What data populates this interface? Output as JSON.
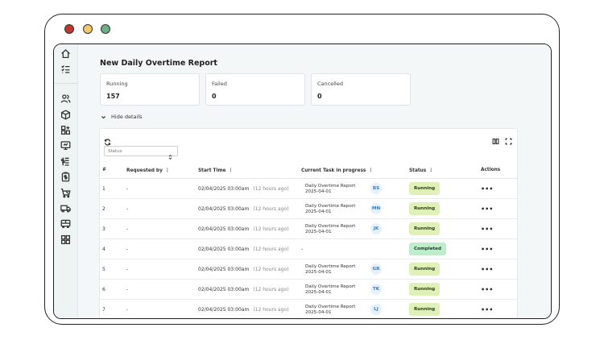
{
  "report": {
    "title": "New Daily Overtime Report"
  },
  "stats": [
    {
      "label": "Running",
      "value": "157"
    },
    {
      "label": "Failed",
      "value": "0"
    },
    {
      "label": "Cancelled",
      "value": "0"
    }
  ],
  "details_toggle": "Hide details",
  "filter": {
    "status_placeholder": "Status"
  },
  "table": {
    "headers": {
      "num": "#",
      "requested_by": "Requested by",
      "start_time": "Start Time",
      "current_task": "Current Task in progress",
      "status": "Status",
      "actions": "Actions"
    },
    "rows": [
      {
        "num": "1",
        "requested_by": "-",
        "start_time": "02/04/2025 03:00am",
        "ago": "(12 hours ago)",
        "task_name": "Daily Overtime Report",
        "task_date": "2025-04-01",
        "task_dash": "",
        "avatar": "BS",
        "status": "Running",
        "actions": "•••"
      },
      {
        "num": "2",
        "requested_by": "-",
        "start_time": "02/04/2025 03:00am",
        "ago": "(12 hours ago)",
        "task_name": "Daily Overtime Report",
        "task_date": "2025-04-01",
        "task_dash": "",
        "avatar": "MN",
        "status": "Running",
        "actions": "•••"
      },
      {
        "num": "3",
        "requested_by": "-",
        "start_time": "02/04/2025 03:00am",
        "ago": "(12 hours ago)",
        "task_name": "Daily Overtime Report",
        "task_date": "2025-04-01",
        "task_dash": "",
        "avatar": "JK",
        "status": "Running",
        "actions": "•••"
      },
      {
        "num": "4",
        "requested_by": "-",
        "start_time": "02/04/2025 03:00am",
        "ago": "(12 hours ago)",
        "task_name": "",
        "task_date": "",
        "task_dash": "-",
        "avatar": "",
        "status": "Completed",
        "actions": "•••"
      },
      {
        "num": "5",
        "requested_by": "-",
        "start_time": "02/04/2025 03:00am",
        "ago": "(12 hours ago)",
        "task_name": "Daily Overtime Report",
        "task_date": "2025-04-01",
        "task_dash": "",
        "avatar": "GR",
        "status": "Running",
        "actions": "•••"
      },
      {
        "num": "6",
        "requested_by": "-",
        "start_time": "02/04/2025 03:00am",
        "ago": "(12 hours ago)",
        "task_name": "Daily Overtime Report",
        "task_date": "2025-04-01",
        "task_dash": "",
        "avatar": "TK",
        "status": "Running",
        "actions": "•••"
      },
      {
        "num": "7",
        "requested_by": "-",
        "start_time": "02/04/2025 03:00am",
        "ago": "(12 hours ago)",
        "task_name": "Daily Overtime Report",
        "task_date": "2025-04-01",
        "task_dash": "",
        "avatar": "LJ",
        "status": "Running",
        "actions": "•••"
      }
    ]
  },
  "sidebar": {
    "icons": [
      "home-icon",
      "checklist-icon",
      "users-icon",
      "box-icon",
      "apps-icon",
      "monitor-icon",
      "billing-icon",
      "clipboard-dollar-icon",
      "cart-icon",
      "truck-icon",
      "bus-icon",
      "grid-icon"
    ]
  },
  "colors": {
    "running_badge": "#dff1b6",
    "completed_badge": "#bfeccb",
    "avatar_bg": "#e6f1fb",
    "avatar_text": "#3a7bbf",
    "sidebar_bg": "#eef3f4",
    "window_red": "#c1352b",
    "window_yellow": "#f1c86b",
    "window_green": "#6dae84"
  }
}
